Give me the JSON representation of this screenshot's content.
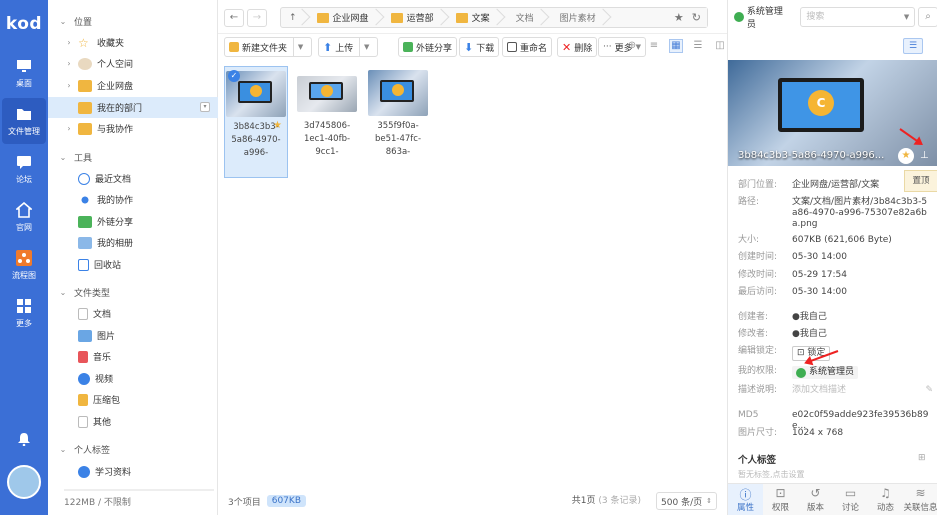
{
  "app": {
    "logo": "kod"
  },
  "rail": {
    "items": [
      {
        "label": "桌面",
        "icon": "monitor-icon"
      },
      {
        "label": "文件管理",
        "icon": "folder-icon"
      },
      {
        "label": "论坛",
        "icon": "chat-icon"
      },
      {
        "label": "官网",
        "icon": "home-icon"
      },
      {
        "label": "流程图",
        "icon": "flowchart-icon"
      },
      {
        "label": "更多",
        "icon": "grid-icon"
      }
    ]
  },
  "tree": {
    "location_title": "位置",
    "location_items": [
      "收藏夹",
      "个人空间",
      "企业网盘",
      "我在的部门",
      "与我协作"
    ],
    "tools_title": "工具",
    "tools_items": [
      "最近文档",
      "我的协作",
      "外链分享",
      "我的相册",
      "回收站"
    ],
    "types_title": "文件类型",
    "types_items": [
      "文档",
      "图片",
      "音乐",
      "视频",
      "压缩包",
      "其他"
    ],
    "tags_title": "个人标签",
    "tags_items": [
      "学习资料"
    ],
    "quota": "122MB / 不限制"
  },
  "breadcrumb": [
    "企业网盘",
    "运营部",
    "文案",
    "文档",
    "图片素材"
  ],
  "toolbar": {
    "new_folder": "新建文件夹",
    "upload": "上传",
    "share_link": "外链分享",
    "download": "下载",
    "rename": "重命名",
    "delete": "删除",
    "more": "更多"
  },
  "files": [
    {
      "name_lines": [
        "3b84c3b3-",
        "5a86-4970-",
        "a996-"
      ],
      "selected": true
    },
    {
      "name_lines": [
        "3d745806-",
        "1ec1-40fb-",
        "9cc1-"
      ],
      "selected": false
    },
    {
      "name_lines": [
        "355f9f0a-",
        "be51-47fc-",
        "863a-"
      ],
      "selected": false
    }
  ],
  "status": {
    "count": "3个项目",
    "size": "607KB",
    "pager": "共1页",
    "pager_note": "(3 条记录)",
    "per_page": "500 条/页"
  },
  "header": {
    "user": "系统管理员",
    "search_placeholder": "搜索"
  },
  "info": {
    "preview_name": "3b84c3b3-5a86-4970-a996...",
    "pin_tooltip": "置顶",
    "props": {
      "dept_label": "部门位置:",
      "dept_value": "企业网盘/运营部/文案",
      "path_label": "路径:",
      "path_value": "文案/文档/图片素材/3b84c3b3-5a86-4970-a996-75307e82a6ba.png",
      "size_label": "大小:",
      "size_value": "607KB (621,606 Byte)",
      "created_label": "创建时间:",
      "created_value": "05-30 14:00",
      "modified_label": "修改时间:",
      "modified_value": "05-29 17:54",
      "accessed_label": "最后访问:",
      "accessed_value": "05-30 14:00",
      "creator_label": "创建者:",
      "creator_value": "我自己",
      "modifier_label": "修改者:",
      "modifier_value": "我自己",
      "lock_label": "编辑锁定:",
      "lock_value": "锁定",
      "perm_label": "我的权限:",
      "perm_value": "系统管理员",
      "desc_label": "描述说明:",
      "desc_placeholder": "添加文档描述",
      "md5_label": "MD5",
      "md5_value": "e02c0f59adde923fe39536b89e...",
      "dim_label": "图片尺寸:",
      "dim_value": "1024 x 768"
    },
    "tags_title": "个人标签",
    "tags_hint": "暂无标签,点击设置"
  },
  "tabs": [
    "属性",
    "权限",
    "版本",
    "讨论",
    "动态",
    "关联信息"
  ],
  "colors": {
    "rail": "#3b6fd6",
    "accent": "#3b82e6",
    "selection": "#dcebfb",
    "arrow": "#e22222"
  }
}
